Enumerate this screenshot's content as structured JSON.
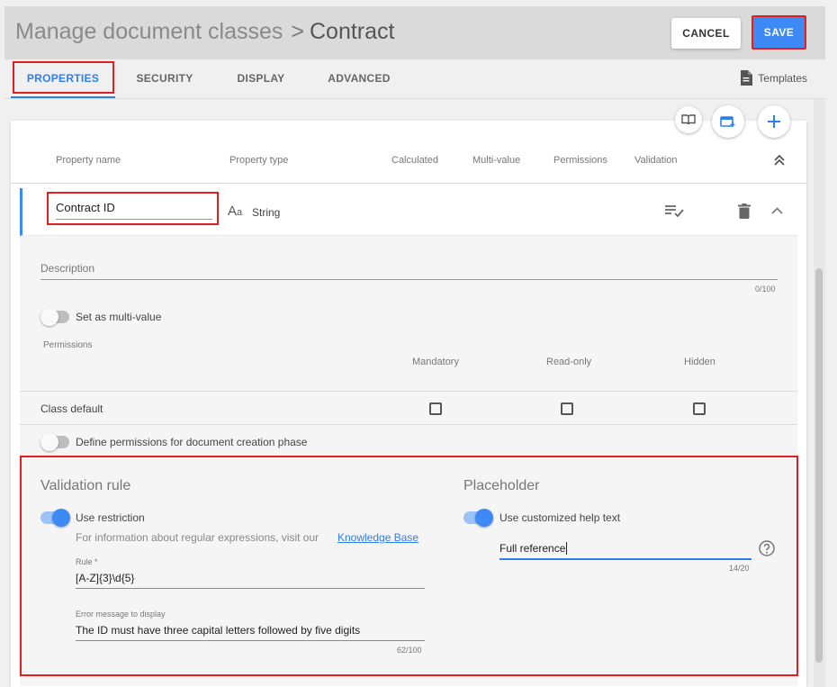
{
  "header": {
    "breadcrumb": "Manage document classes",
    "separator": ">",
    "current": "Contract",
    "cancel_label": "CANCEL",
    "save_label": "SAVE"
  },
  "tabs": [
    {
      "label": "PROPERTIES",
      "active": true
    },
    {
      "label": "SECURITY"
    },
    {
      "label": "DISPLAY"
    },
    {
      "label": "ADVANCED"
    }
  ],
  "templates_label": "Templates",
  "toolbar_icons": [
    "book-open-icon",
    "add-panel-icon",
    "plus-icon"
  ],
  "columns": [
    "Property name",
    "Property type",
    "Calculated",
    "Multi-value",
    "Permissions",
    "Validation"
  ],
  "property": {
    "name": "Contract ID",
    "type": "String"
  },
  "details": {
    "description_label": "Description",
    "description_count": "0/100",
    "multivalue_label": "Set as multi-value",
    "permissions_label": "Permissions",
    "perm_columns": [
      "Mandatory",
      "Read-only",
      "Hidden"
    ],
    "class_default_label": "Class default",
    "creation_phase_label": "Define permissions for document creation phase"
  },
  "validation": {
    "title": "Validation rule",
    "use_restriction_label": "Use restriction",
    "info_text": "For information about regular expressions, visit our",
    "link_text": "Knowledge Base",
    "rule_label": "Rule *",
    "rule_value": "[A-Z]{3}\\d{5}",
    "error_label": "Error message to display",
    "error_value": "The ID must have three capital letters followed by five digits",
    "error_count": "62/100"
  },
  "placeholder": {
    "title": "Placeholder",
    "toggle_label": "Use customized help text",
    "value": "Full reference",
    "count": "14/20"
  },
  "colors": {
    "accent": "#3d8af7",
    "highlight": "#e02020"
  }
}
